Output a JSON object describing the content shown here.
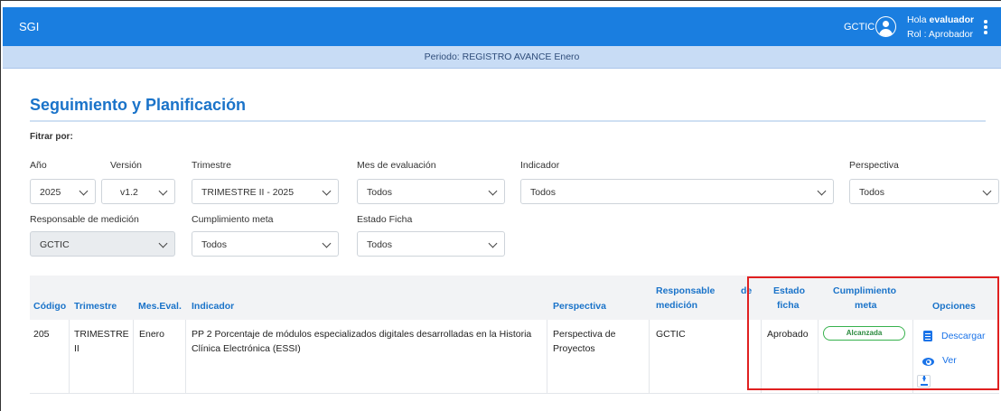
{
  "header": {
    "app_title": "SGI",
    "user_code": "GCTIC",
    "greeting_prefix": "Hola ",
    "username": "evaluador",
    "role": "Rol : Aprobador"
  },
  "period": "Periodo: REGISTRO AVANCE Enero",
  "page_title": "Seguimiento y Planificación",
  "filter_by_label": "Fitrar por:",
  "filters": {
    "year": {
      "label": "Año",
      "value": "2025"
    },
    "version": {
      "label": "Versión",
      "value": "v1.2"
    },
    "quarter": {
      "label": "Trimestre",
      "value": "TRIMESTRE II - 2025"
    },
    "eval_month": {
      "label": "Mes de evaluación",
      "value": "Todos"
    },
    "indicator": {
      "label": "Indicador",
      "value": "Todos"
    },
    "perspective": {
      "label": "Perspectiva",
      "value": "Todos"
    },
    "responsible": {
      "label": "Responsable de medición",
      "value": "GCTIC"
    },
    "goal_compliance": {
      "label": "Cumplimiento meta",
      "value": "Todos"
    },
    "sheet_status": {
      "label": "Estado Ficha",
      "value": "Todos"
    }
  },
  "table": {
    "headers": {
      "code": "Código",
      "quarter": "Trimestre",
      "month": "Mes.Eval.",
      "indicator": "Indicador",
      "perspective": "Perspectiva",
      "responsible_1": "Responsable",
      "responsible_de": "de",
      "responsible_2": "medición",
      "status_1": "Estado",
      "status_2": "ficha",
      "compliance_1": "Cumplimiento",
      "compliance_2": "meta",
      "options": "Opciones"
    },
    "rows": [
      {
        "code": "205",
        "quarter_1": "TRIMESTRE",
        "quarter_2": "II",
        "month": "Enero",
        "indicator_1": "PP 2 Porcentaje de módulos especializados digitales desarrolladas en la Historia",
        "indicator_2": "Clínica Electrónica (ESSI)",
        "perspective_1": "Perspectiva de",
        "perspective_2": "Proyectos",
        "responsible": "GCTIC",
        "status": "Aprobado",
        "compliance": "Alcanzada",
        "option_download": "Descargar",
        "option_view": "Ver"
      }
    ]
  },
  "colors": {
    "primary": "#1a7ee0",
    "accent_text": "#1a73c9",
    "highlight_box": "#e02020",
    "badge_green": "#37b24d"
  }
}
